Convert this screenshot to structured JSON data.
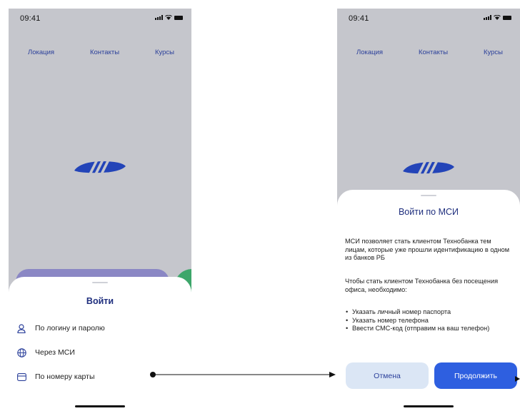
{
  "status_bar": {
    "time": "09:41"
  },
  "top_nav": [
    "Локация",
    "Контакты",
    "Курсы"
  ],
  "login_sheet": {
    "title": "Войти",
    "options": [
      {
        "label": "По логину и паролю",
        "icon": "user-icon"
      },
      {
        "label": "Через МСИ",
        "icon": "globe-icon"
      },
      {
        "label": "По номеру карты",
        "icon": "card-icon"
      }
    ]
  },
  "msi_sheet": {
    "title": "Войти по МСИ",
    "intro": "МСИ позволяет стать клиентом Технобанка тем лицам, которые уже прошли идентификацию в одном из банков РБ",
    "requirements_intro": "Чтобы стать клиентом Технобанка без посещения офиса, необходимо:",
    "requirements": [
      "Указать личный номер паспорта",
      "Указать номер телефона",
      "Ввести СМС-код (отправим на ваш телефон)"
    ],
    "cancel_label": "Отмена",
    "continue_label": "Продолжить"
  },
  "colors": {
    "background": "#c5c6cc",
    "title": "#1f2f7e",
    "link": "#2a3f9a",
    "primary_button": "#2e5fe0",
    "secondary_button": "#dbe6f5",
    "logo": "#2344b8"
  }
}
